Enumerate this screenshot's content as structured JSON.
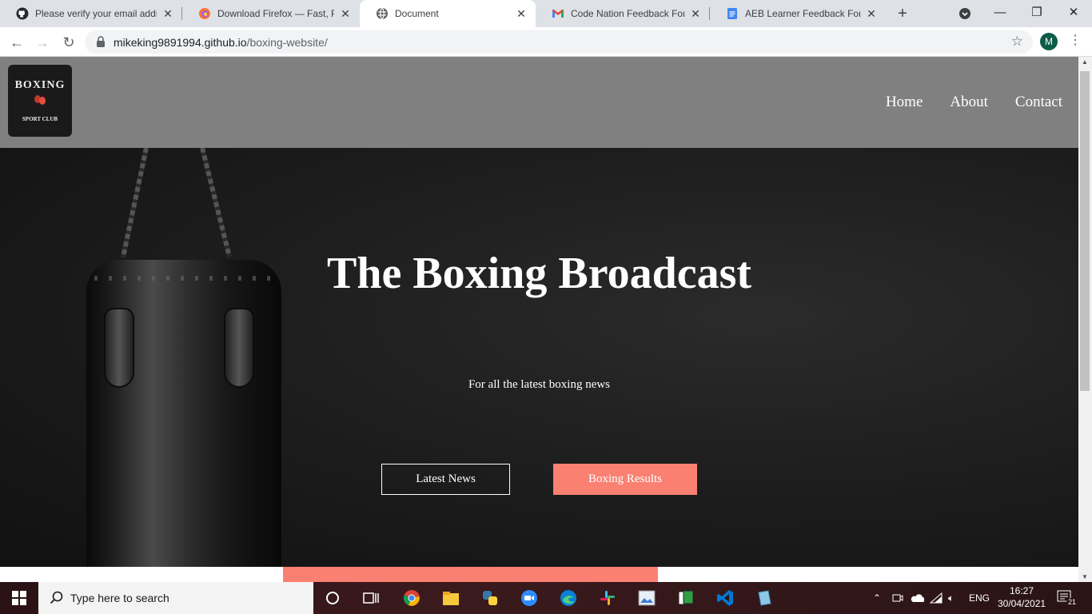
{
  "browser": {
    "tabs": [
      {
        "title": "Please verify your email addre",
        "icon": "github-icon",
        "active": false
      },
      {
        "title": "Download Firefox — Fast, Priv",
        "icon": "firefox-icon",
        "active": false
      },
      {
        "title": "Document",
        "icon": "globe-icon",
        "active": true
      },
      {
        "title": "Code Nation Feedback Form",
        "icon": "gmail-icon",
        "active": false
      },
      {
        "title": "AEB Learner Feedback Form.d",
        "icon": "docs-icon",
        "active": false
      }
    ],
    "new_tab": "+",
    "url_host": "mikeking9891994.github.io",
    "url_path": "/boxing-website/",
    "profile_initial": "M"
  },
  "site": {
    "logo": {
      "line1": "BOXING",
      "line2": "SPORT CLUB"
    },
    "nav": [
      "Home",
      "About",
      "Contact"
    ],
    "hero": {
      "title": "The Boxing Broadcast",
      "subtitle": "For all the latest boxing news",
      "btn_primary": "Latest News",
      "btn_secondary": "Boxing Results"
    },
    "colors": {
      "header": "#808080",
      "accent": "#fa8072",
      "hero_bg": "#1e1e1e"
    }
  },
  "taskbar": {
    "search_placeholder": "Type here to search",
    "language": "ENG",
    "time": "16:27",
    "date": "30/04/2021",
    "notification_count": "21"
  }
}
